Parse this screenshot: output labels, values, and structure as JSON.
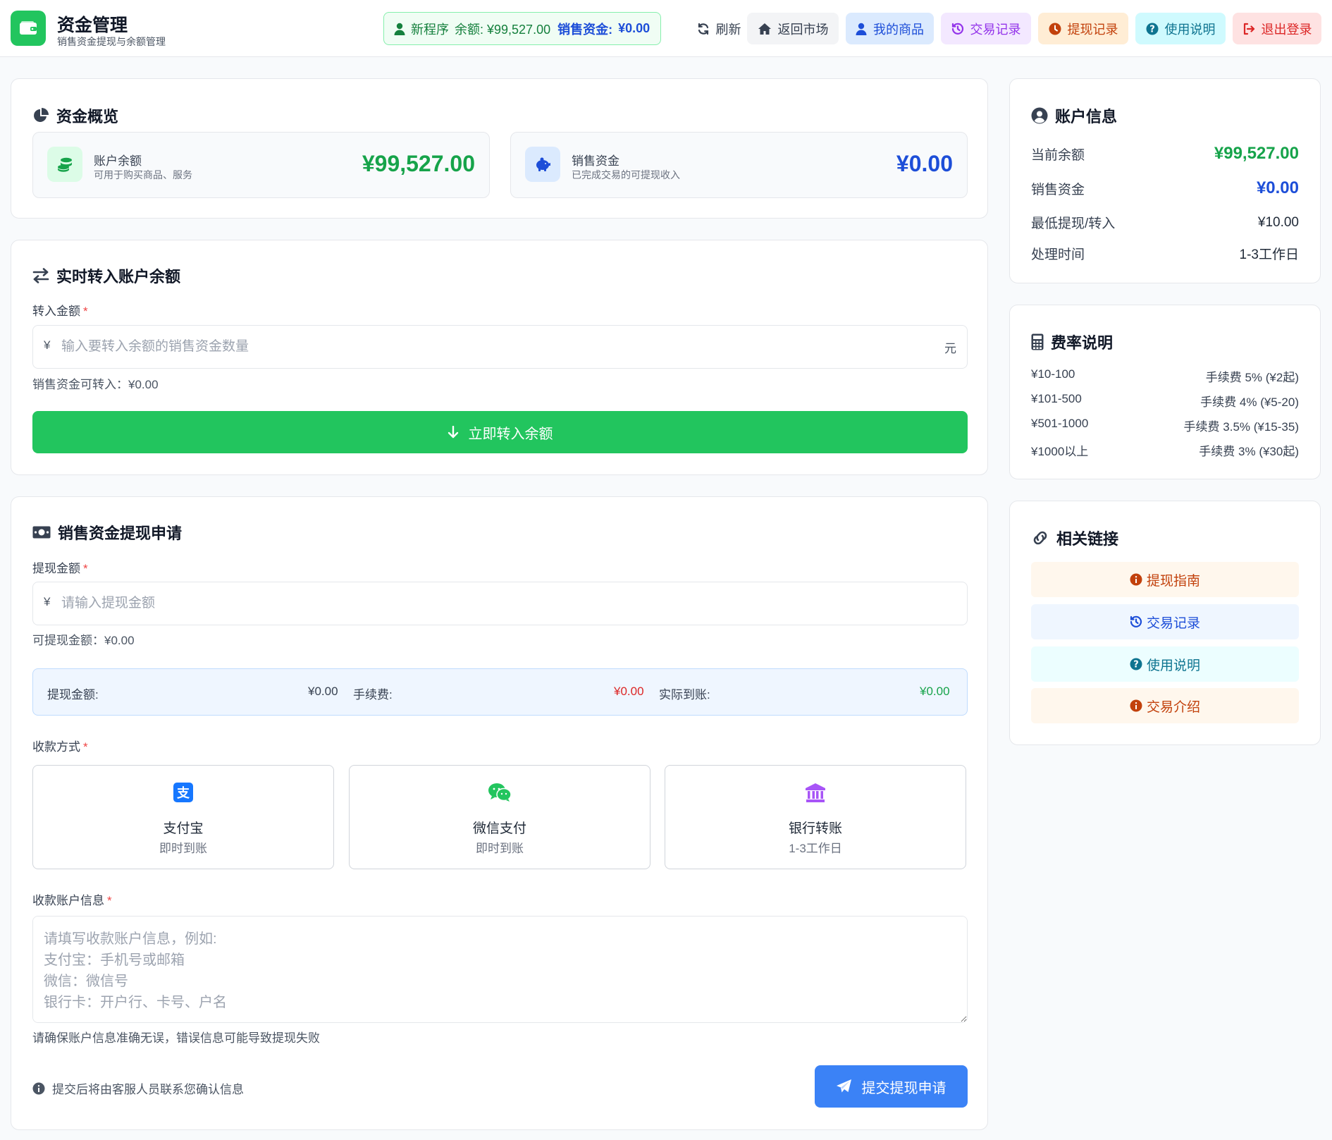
{
  "header": {
    "title": "资金管理",
    "subtitle": "销售资金提现与余额管理",
    "user_name": "新程序",
    "balance_text": "余额: ¥99,527.00",
    "sales_label": "销售资金:",
    "sales_value": "¥0.00",
    "buttons": {
      "refresh": "刷新",
      "market": "返回市场",
      "my_goods": "我的商品",
      "transactions": "交易记录",
      "withdraw_records": "提现记录",
      "help": "使用说明",
      "logout": "退出登录"
    }
  },
  "overview": {
    "title": "资金概览",
    "account_balance": {
      "label": "账户余额",
      "desc": "可用于购买商品、服务",
      "value": "¥99,527.00"
    },
    "sales_funds": {
      "label": "销售资金",
      "desc": "已完成交易的可提现收入",
      "value": "¥0.00"
    }
  },
  "transfer": {
    "title": "实时转入账户余额",
    "amount_label": "转入金额",
    "required_mark": "*",
    "currency": "¥",
    "placeholder": "输入要转入余额的销售资金数量",
    "unit": "元",
    "available": "销售资金可转入：¥0.00",
    "button": "立即转入余额"
  },
  "withdraw": {
    "title": "销售资金提现申请",
    "amount_label": "提现金额",
    "required_mark": "*",
    "currency": "¥",
    "placeholder": "请输入提现金额",
    "available": "可提现金额：¥0.00",
    "calc": {
      "amount_label": "提现金额:",
      "amount_value": "¥0.00",
      "fee_label": "手续费:",
      "fee_value": "¥0.00",
      "actual_label": "实际到账:",
      "actual_value": "¥0.00"
    },
    "method_label": "收款方式",
    "methods": [
      {
        "name": "支付宝",
        "desc": "即时到账",
        "icon": "alipay-icon"
      },
      {
        "name": "微信支付",
        "desc": "即时到账",
        "icon": "wechat-icon"
      },
      {
        "name": "银行转账",
        "desc": "1-3工作日",
        "icon": "bank-icon"
      }
    ],
    "account_label": "收款账户信息",
    "account_placeholder": "请填写收款账户信息，例如:\n支付宝：手机号或邮箱\n微信：微信号\n银行卡：开户行、卡号、户名",
    "account_hint": "请确保账户信息准确无误，错误信息可能导致提现失败",
    "notice": "提交后将由客服人员联系您确认信息",
    "submit": "提交提现申请"
  },
  "account_info": {
    "title": "账户信息",
    "rows": [
      {
        "key": "当前余额",
        "value": "¥99,527.00"
      },
      {
        "key": "销售资金",
        "value": "¥0.00"
      },
      {
        "key": "最低提现/转入",
        "value": "¥10.00"
      },
      {
        "key": "处理时间",
        "value": "1-3工作日"
      }
    ]
  },
  "fees": {
    "title": "费率说明",
    "rows": [
      {
        "range": "¥10-100",
        "fee": "手续费 5% (¥2起)"
      },
      {
        "range": "¥101-500",
        "fee": "手续费 4% (¥5-20)"
      },
      {
        "range": "¥501-1000",
        "fee": "手续费 3.5% (¥15-35)"
      },
      {
        "range": "¥1000以上",
        "fee": "手续费 3% (¥30起)"
      }
    ]
  },
  "links": {
    "title": "相关链接",
    "items": [
      {
        "label": "提现指南",
        "icon": "info-icon"
      },
      {
        "label": "交易记录",
        "icon": "history-icon"
      },
      {
        "label": "使用说明",
        "icon": "question-icon"
      },
      {
        "label": "交易介绍",
        "icon": "info-icon"
      }
    ]
  },
  "colors": {
    "primary_green": "#22c55e",
    "value_green": "#16a34a",
    "value_blue": "#1d4ed8",
    "submit_blue": "#3b82f6",
    "fee_red": "#dc2626"
  }
}
